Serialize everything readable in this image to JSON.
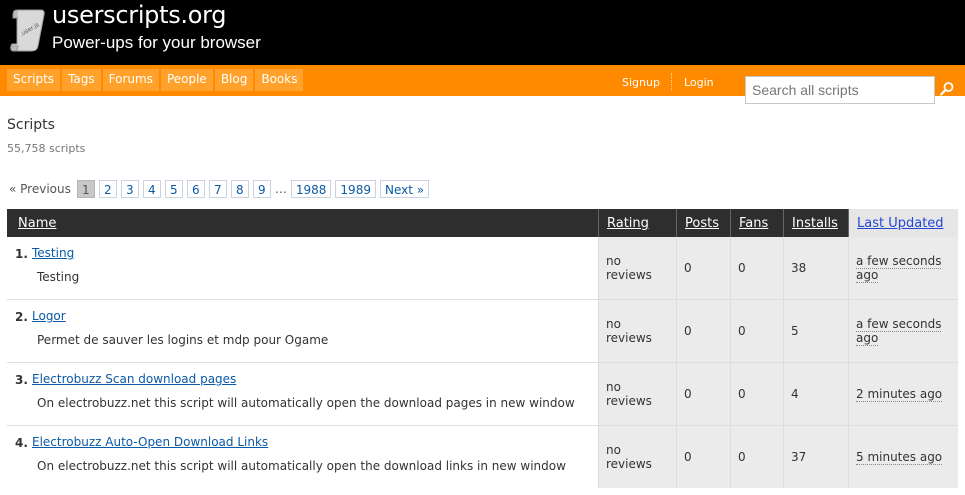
{
  "site": {
    "title": "userscripts.org",
    "tagline": "Power-ups for your browser"
  },
  "nav": {
    "items": [
      "Scripts",
      "Tags",
      "Forums",
      "People",
      "Blog",
      "Books"
    ],
    "signup": "Signup",
    "login": "Login"
  },
  "search": {
    "placeholder": "Search all scripts"
  },
  "page": {
    "title": "Scripts",
    "count": "55,758 scripts"
  },
  "pagination": {
    "prev": "« Previous",
    "pages": [
      "1",
      "2",
      "3",
      "4",
      "5",
      "6",
      "7",
      "8",
      "9"
    ],
    "current": "1",
    "ellipsis": "…",
    "last_pages": [
      "1988",
      "1989"
    ],
    "next": "Next »"
  },
  "table": {
    "headers": {
      "name": "Name",
      "rating": "Rating",
      "posts": "Posts",
      "fans": "Fans",
      "installs": "Installs",
      "updated": "Last Updated"
    },
    "rows": [
      {
        "num": "1.",
        "name": "Testing",
        "desc": "Testing",
        "rating": "no reviews",
        "posts": "0",
        "fans": "0",
        "installs": "38",
        "updated_1": "a few seconds",
        "updated_2": "ago"
      },
      {
        "num": "2.",
        "name": "Logor",
        "desc": "Permet de sauver les logins et mdp pour Ogame",
        "rating": "no reviews",
        "posts": "0",
        "fans": "0",
        "installs": "5",
        "updated_1": "a few seconds",
        "updated_2": "ago"
      },
      {
        "num": "3.",
        "name": "Electrobuzz Scan download pages",
        "desc": "On electrobuzz.net this script will automatically open the download pages in new window",
        "rating": "no reviews",
        "posts": "0",
        "fans": "0",
        "installs": "4",
        "updated_1": "2 minutes ago",
        "updated_2": ""
      },
      {
        "num": "4.",
        "name": "Electrobuzz Auto-Open Download Links",
        "desc": "On electrobuzz.net this script will automatically open the download links in new window",
        "rating": "no reviews",
        "posts": "0",
        "fans": "0",
        "installs": "37",
        "updated_1": "5 minutes ago",
        "updated_2": ""
      }
    ]
  },
  "colors": {
    "header_bg": "#000000",
    "nav_bg": "#ff8a00",
    "nav_item_bg": "#ffa12b",
    "table_header_bg": "#2e2e2e",
    "link": "#0b5aa6"
  }
}
